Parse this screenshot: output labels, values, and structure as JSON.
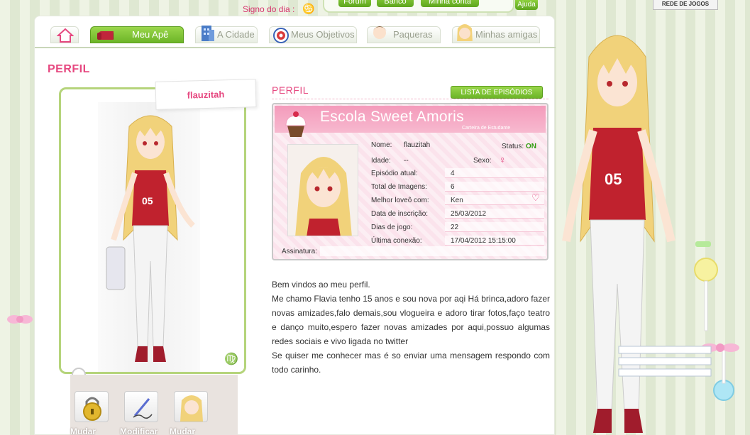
{
  "topbar": {
    "signo_label": "Signo do dia :",
    "signo_icon": "cancer-icon",
    "nav": [
      {
        "label": "Fórum"
      },
      {
        "label": "Banco"
      },
      {
        "label": "Minha conta"
      },
      {
        "label": "Ajuda"
      }
    ],
    "rede_jogos": "REDE DE JOGOS"
  },
  "tabs": [
    {
      "label": "",
      "icon": "home-icon",
      "active": false
    },
    {
      "label": "Meu Apê",
      "icon": "sofa-icon",
      "active": true
    },
    {
      "label": "A Cidade",
      "icon": "building-icon",
      "active": false
    },
    {
      "label": "Meus Objetivos",
      "icon": "target-icon",
      "active": false
    },
    {
      "label": "Paqueras",
      "icon": "boy-avatar-icon",
      "active": false
    },
    {
      "label": "Minhas amigas",
      "icon": "girl-avatar-icon",
      "active": false
    }
  ],
  "page_title": "PERFIL",
  "avatar": {
    "username": "flauzitah",
    "zodiac_icon": "virgo-icon"
  },
  "actions": [
    {
      "label": "Mudar",
      "icon": "padlock-icon"
    },
    {
      "label": "Modificar",
      "icon": "pen-icon"
    },
    {
      "label": "Mudar",
      "icon": "avatar-icon"
    }
  ],
  "profile": {
    "section_title": "PERFIL",
    "episodes_button": "LISTA DE EPISÓDIOS",
    "card": {
      "school": "Escola Sweet Amoris",
      "subtitle": "Carteira de Estudante",
      "fields": {
        "nome_label": "Nome:",
        "nome": "flauzitah",
        "status_label": "Status:",
        "status": "ON",
        "idade_label": "Idade:",
        "idade": "--",
        "sexo_label": "Sexo:",
        "sexo_icon": "female-icon",
        "episodio_label": "Episódio atual:",
        "episodio": "4",
        "imagens_label": "Total de Imagens:",
        "imagens": "6",
        "lovedo_label": "Melhor loveô com:",
        "lovedo": "Ken",
        "inscricao_label": "Data de inscrição:",
        "inscricao": "25/03/2012",
        "dias_label": "Dias de jogo:",
        "dias": "22",
        "conexao_label": "Última conexão:",
        "conexao": "17/04/2012 15:15:00",
        "assinatura_label": "Assinatura:"
      }
    },
    "bio": [
      "Bem vindos ao meu perfil.",
      "Me chamo Flavia tenho 15 anos e sou nova por aqi Há brinca,adoro fazer novas amizades,falo demais,sou vlogueira e adoro tirar fotos,faço teatro e danço muito,espero fazer novas amizades por aqui,possuo algumas redes sociais e vivo ligada no twitter",
      "Se quiser me conhecer mas é so enviar uma mensagem respondo com todo carinho."
    ]
  },
  "colors": {
    "accent_pink": "#e64880",
    "accent_green": "#6cb527",
    "card_pink": "#f49bbb"
  }
}
